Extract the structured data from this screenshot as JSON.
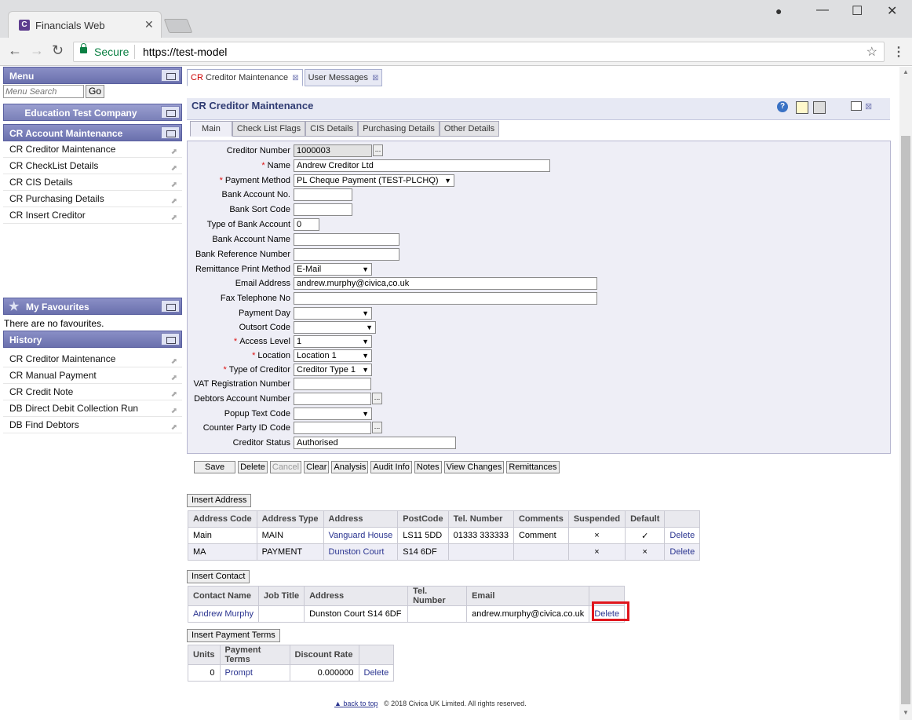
{
  "browser": {
    "tab_title": "Financials Web",
    "tab_favicon": "C",
    "secure_label": "Secure",
    "url": "https://test-model"
  },
  "sidebar": {
    "menu_title": "Menu",
    "menu_search_placeholder": "Menu Search",
    "go_label": "Go",
    "company": "Education Test Company",
    "section": "CR Account Maintenance",
    "items": [
      "CR Creditor Maintenance",
      "CR CheckList Details",
      "CR CIS Details",
      "CR Purchasing Details",
      "CR Insert Creditor"
    ],
    "favourites_title": "My Favourites",
    "favourites_empty": "There are no favourites.",
    "history_title": "History",
    "history": [
      "CR Creditor Maintenance",
      "CR Manual Payment",
      "CR Credit Note",
      "DB Direct Debit Collection Run",
      "DB Find Debtors"
    ]
  },
  "content_tabs": {
    "t1_prefix": "CR",
    "t1_label": "Creditor Maintenance",
    "t2_label": "User Messages"
  },
  "form": {
    "title": "CR Creditor Maintenance",
    "subtabs": [
      "Main",
      "Check List Flags",
      "CIS Details",
      "Purchasing Details",
      "Other Details"
    ],
    "fields": {
      "creditor_number": {
        "label": "Creditor Number",
        "value": "1000003"
      },
      "name": {
        "label": "Name",
        "value": "Andrew Creditor Ltd"
      },
      "payment_method": {
        "label": "Payment Method",
        "value": "PL Cheque Payment (TEST-PLCHQ)"
      },
      "bank_account_no": {
        "label": "Bank Account No.",
        "value": ""
      },
      "bank_sort_code": {
        "label": "Bank Sort Code",
        "value": ""
      },
      "type_of_bank_account": {
        "label": "Type of Bank Account",
        "value": "0"
      },
      "bank_account_name": {
        "label": "Bank Account Name",
        "value": ""
      },
      "bank_reference_number": {
        "label": "Bank Reference Number",
        "value": ""
      },
      "remittance_print_method": {
        "label": "Remittance Print Method",
        "value": "E-Mail"
      },
      "email_address": {
        "label": "Email Address",
        "value": "andrew.murphy@civica,co.uk"
      },
      "fax_telephone_no": {
        "label": "Fax Telephone No",
        "value": ""
      },
      "payment_day": {
        "label": "Payment Day",
        "value": ""
      },
      "outsort_code": {
        "label": "Outsort Code",
        "value": ""
      },
      "access_level": {
        "label": "Access Level",
        "value": "1"
      },
      "location": {
        "label": "Location",
        "value": "Location 1"
      },
      "type_of_creditor": {
        "label": "Type of Creditor",
        "value": "Creditor Type 1"
      },
      "vat_registration_number": {
        "label": "VAT Registration Number",
        "value": ""
      },
      "debtors_account_number": {
        "label": "Debtors Account Number",
        "value": ""
      },
      "popup_text_code": {
        "label": "Popup Text Code",
        "value": ""
      },
      "counter_party_id_code": {
        "label": "Counter Party ID Code",
        "value": ""
      },
      "creditor_status": {
        "label": "Creditor Status",
        "value": "Authorised"
      }
    },
    "actions": [
      "Save",
      "Delete",
      "Cancel",
      "Clear",
      "Analysis",
      "Audit Info",
      "Notes",
      "View Changes",
      "Remittances"
    ]
  },
  "address": {
    "insert_label": "Insert Address",
    "columns": [
      "Address Code",
      "Address Type",
      "Address",
      "PostCode",
      "Tel. Number",
      "Comments",
      "Suspended",
      "Default",
      ""
    ],
    "rows": [
      {
        "code": "Main",
        "type": "MAIN",
        "address": "Vanguard House",
        "postcode": "LS11 5DD",
        "tel": "01333 333333",
        "comments": "Comment",
        "suspended": "×",
        "default": "✓",
        "action": "Delete"
      },
      {
        "code": "MA",
        "type": "PAYMENT",
        "address": "Dunston Court",
        "postcode": "S14 6DF",
        "tel": "",
        "comments": "",
        "suspended": "×",
        "default": "×",
        "action": "Delete"
      }
    ]
  },
  "contact": {
    "insert_label": "Insert Contact",
    "columns": [
      "Contact Name",
      "Job Title",
      "Address",
      "Tel. Number",
      "Email",
      ""
    ],
    "rows": [
      {
        "name": "Andrew Murphy",
        "job": "",
        "address": "Dunston Court S14 6DF",
        "tel": "",
        "email": "andrew.murphy@civica.co.uk",
        "action": "Delete"
      }
    ]
  },
  "payment_terms": {
    "insert_label": "Insert Payment Terms",
    "columns": [
      "Units",
      "Payment Terms",
      "Discount Rate",
      ""
    ],
    "rows": [
      {
        "units": "0",
        "terms": "Prompt",
        "discount": "0.000000",
        "action": "Delete"
      }
    ]
  },
  "footer": {
    "back_to_top": "back to top",
    "copyright": "© 2018 Civica UK Limited. All rights reserved."
  }
}
